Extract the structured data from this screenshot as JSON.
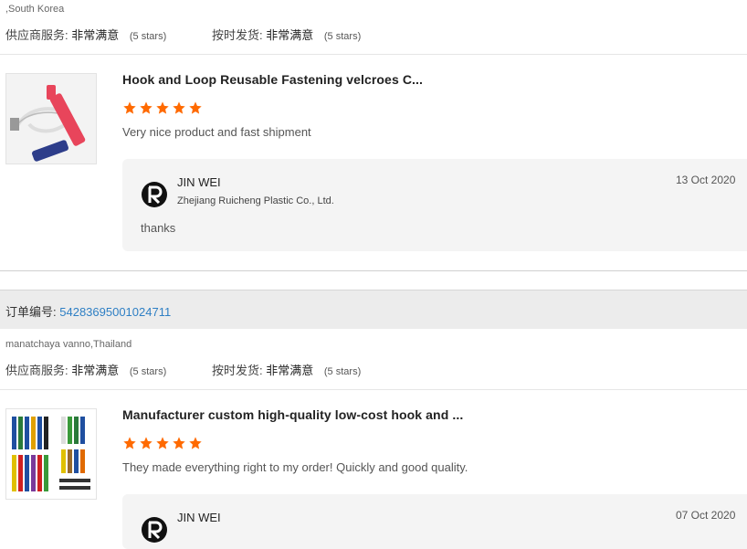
{
  "reviews": [
    {
      "buyer": ",South Korea",
      "supplier_service_label": "供应商服务:",
      "supplier_service_value": "非常满意",
      "supplier_service_stars": "(5 stars)",
      "ontime_label": "按时发货:",
      "ontime_value": "非常满意",
      "ontime_stars": "(5 stars)",
      "product_title": "Hook and Loop Reusable Fastening velcroes C...",
      "rating": 5,
      "review_text": "Very nice product and fast shipment",
      "reply": {
        "name": "JIN WEI",
        "company": "Zhejiang Ruicheng Plastic Co., Ltd.",
        "date": "13 Oct 2020",
        "message": "thanks"
      }
    },
    {
      "order_label": "订单编号:",
      "order_number": "54283695001024711",
      "buyer": "manatchaya vanno,Thailand",
      "supplier_service_label": "供应商服务:",
      "supplier_service_value": "非常满意",
      "supplier_service_stars": "(5 stars)",
      "ontime_label": "按时发货:",
      "ontime_value": "非常满意",
      "ontime_stars": "(5 stars)",
      "product_title": "Manufacturer custom high-quality low-cost hook and ...",
      "rating": 5,
      "review_text": "They made everything right to my order! Quickly and good quality.",
      "reply": {
        "name": "JIN WEI",
        "date": "07 Oct 2020"
      }
    }
  ],
  "colors": {
    "star": "#ff6a00",
    "link": "#2e7fc4",
    "reply_bg": "#f4f4f4"
  },
  "icons": {
    "star": "star-icon",
    "logo": "ruicheng-logo-icon"
  }
}
